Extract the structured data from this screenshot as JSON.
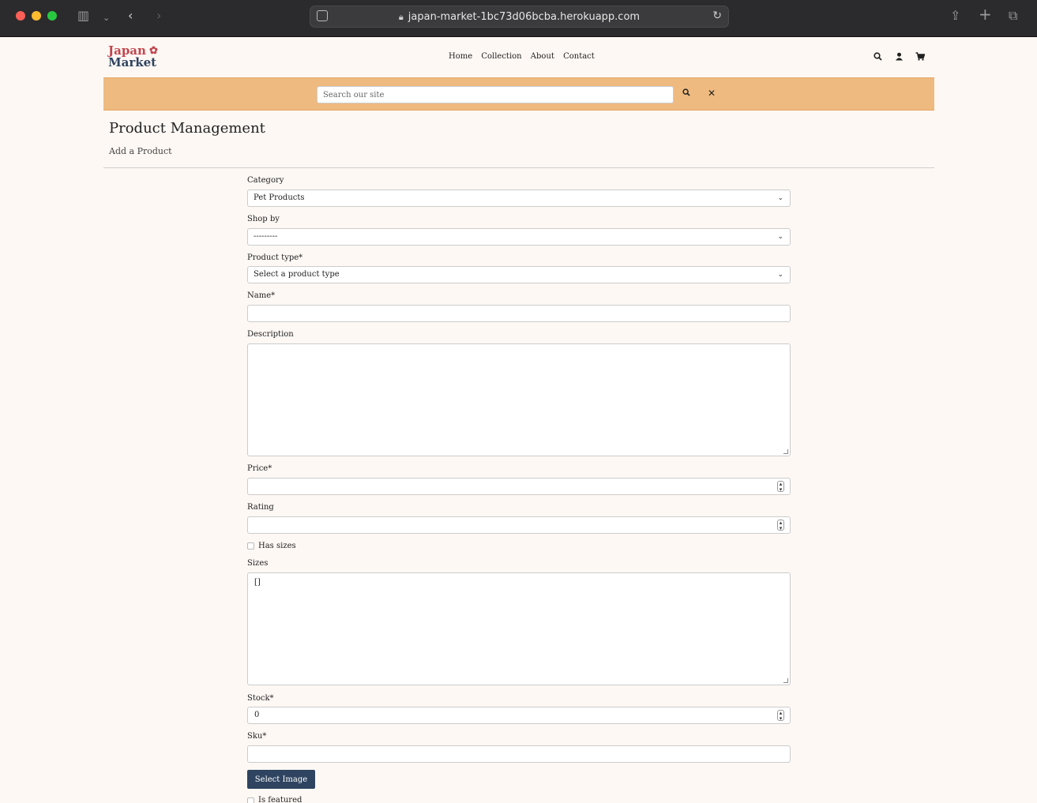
{
  "browser": {
    "url": "japan-market-1bc73d06bcba.herokuapp.com"
  },
  "site": {
    "logo_line1": "Japan",
    "logo_line2": "Market",
    "nav": [
      "Home",
      "Collection",
      "About",
      "Contact"
    ]
  },
  "search": {
    "placeholder": "Search our site"
  },
  "page": {
    "title": "Product Management",
    "subtitle": "Add a Product"
  },
  "form": {
    "category_label": "Category",
    "category_value": "Pet Products",
    "shopby_label": "Shop by",
    "shopby_value": "---------",
    "product_type_label": "Product type*",
    "product_type_value": "Select a product type",
    "name_label": "Name*",
    "description_label": "Description",
    "price_label": "Price*",
    "rating_label": "Rating",
    "has_sizes_label": "Has sizes",
    "sizes_label": "Sizes",
    "sizes_value": "[]",
    "stock_label": "Stock*",
    "stock_value": "0",
    "sku_label": "Sku*",
    "select_image_label": "Select Image",
    "is_featured_label": "Is featured"
  },
  "colors": {
    "accent": "#2e4460",
    "search_band": "#efba80",
    "logo_red": "#c0464f"
  }
}
